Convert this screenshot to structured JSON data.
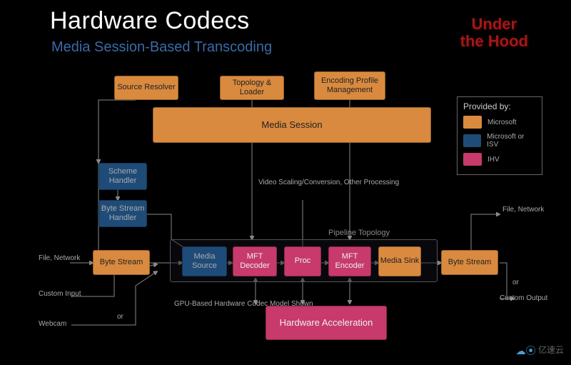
{
  "header": {
    "title": "Hardware Codecs",
    "subtitle": "Media Session-Based Transcoding",
    "corner1": "Under",
    "corner2": "the Hood"
  },
  "boxes": {
    "source_resolver": "Source\nResolver",
    "topology_loader": "Topology &\nLoader",
    "encoding_profile": "Encoding\nProfile\nManagement",
    "media_session": "Media Session",
    "scheme_handler": "Scheme\nHandler",
    "byte_stream_handler": "Byte\nStream\nHandler",
    "byte_stream_in": "Byte\nStream",
    "media_source": "Media\nSource",
    "mft_decoder": "MFT\nDecoder",
    "proc": "Proc",
    "mft_encoder": "MFT\nEncoder",
    "media_sink": "Media\nSink",
    "byte_stream_out": "Byte\nStream",
    "hardware_accel": "Hardware\nAcceleration"
  },
  "labels": {
    "video_processing": "Video\nScaling/Conversion,\nOther Processing",
    "pipeline_topology": "Pipeline Topology",
    "gpu_model": "GPU-Based\nHardware Codec\nModel Shown",
    "file_network_left": "File,\nNetwork",
    "custom_input": "Custom\nInput",
    "webcam": "Webcam",
    "or_left": "or",
    "file_network_right": "File,\nNetwork",
    "custom_output": "Custom\nOutput",
    "or_right": "or"
  },
  "legend": {
    "title": "Provided by:",
    "items": [
      {
        "color": "orange",
        "label": "Microsoft"
      },
      {
        "color": "blue",
        "label": "Microsoft or ISV"
      },
      {
        "color": "pink",
        "label": "IHV"
      }
    ]
  },
  "watermark": "亿速云"
}
